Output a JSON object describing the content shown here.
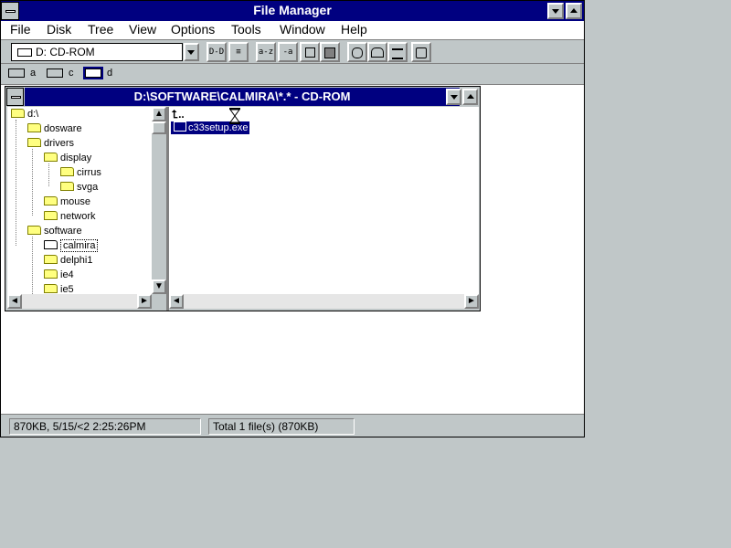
{
  "window": {
    "title": "File Manager"
  },
  "menu": [
    "File",
    "Disk",
    "Tree",
    "View",
    "Options",
    "Tools",
    "Window",
    "Help"
  ],
  "toolbar": {
    "drive_combo_value": "D: CD-ROM",
    "buttons": [
      "connect-network-drive",
      "disconnect-network-drive",
      "name-view",
      "all-details-view",
      "sort-by-name",
      "sort-by-type",
      "sort-by-size",
      "sort-by-date",
      "new-window",
      "connect-net",
      "share-as",
      "stop-sharing",
      "view-icon"
    ],
    "button_glyphs": [
      "D-D",
      "D-D",
      "≡",
      "≡",
      "a-z",
      "-a",
      "",
      "",
      "",
      "",
      "",
      "",
      ""
    ]
  },
  "drives": [
    {
      "letter": "a",
      "icon": "floppy-drive-icon",
      "selected": false
    },
    {
      "letter": "c",
      "icon": "hard-drive-icon",
      "selected": false
    },
    {
      "letter": "d",
      "icon": "cdrom-drive-icon",
      "selected": true
    }
  ],
  "child_window": {
    "title": "D:\\SOFTWARE\\CALMIRA\\*.* - CD-ROM"
  },
  "tree": [
    {
      "label": "d:\\",
      "level": 0,
      "open": false
    },
    {
      "label": "dosware",
      "level": 1,
      "open": false
    },
    {
      "label": "drivers",
      "level": 1,
      "open": false
    },
    {
      "label": "display",
      "level": 2,
      "open": false
    },
    {
      "label": "cirrus",
      "level": 3,
      "open": false
    },
    {
      "label": "svga",
      "level": 3,
      "open": false
    },
    {
      "label": "mouse",
      "level": 2,
      "open": false
    },
    {
      "label": "network",
      "level": 2,
      "open": false
    },
    {
      "label": "software",
      "level": 1,
      "open": false
    },
    {
      "label": "calmira",
      "level": 2,
      "open": true,
      "selected": true
    },
    {
      "label": "delphi1",
      "level": 2,
      "open": false
    },
    {
      "label": "ie4",
      "level": 2,
      "open": false
    },
    {
      "label": "ie5",
      "level": 2,
      "open": false
    }
  ],
  "files": [
    {
      "name": "..",
      "type": "up-folder"
    },
    {
      "name": "c33setup.exe",
      "type": "exe",
      "selected": true
    }
  ],
  "status": {
    "left": "870KB, 5/15/<2 2:25:26PM",
    "right": "Total 1 file(s) (870KB)"
  },
  "colors": {
    "titlebar": "#000080",
    "desktop": "#c0c7c8",
    "selection": "#000080"
  }
}
